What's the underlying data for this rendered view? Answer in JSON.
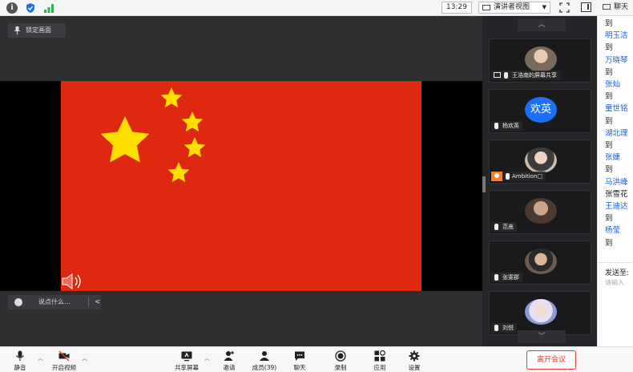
{
  "topbar": {
    "time": "13:29",
    "view_mode": "演讲者视图",
    "chat_title": "聊天",
    "icons": [
      "info-icon",
      "shield-icon",
      "signal-icon",
      "fullscreen-icon",
      "sidebar-icon"
    ]
  },
  "main": {
    "lock_button": "锁定画面",
    "say_placeholder": "说点什么...",
    "say_chevron": "<",
    "shared_content": "chinese-flag"
  },
  "participants": {
    "scroll_up": "^",
    "scroll_down": "v",
    "tiles": [
      {
        "name": "王浩南的屏幕共享",
        "avatar": "photo"
      },
      {
        "name": "杨欢英",
        "avatar_text": "欢英"
      },
      {
        "name": "Ambition□",
        "avatar": "photo",
        "host": true
      },
      {
        "name": "范嵩",
        "avatar": "photo"
      },
      {
        "name": "张雯郡",
        "avatar": "photo"
      },
      {
        "name": "刘悦",
        "avatar": "photo"
      }
    ]
  },
  "chat": {
    "lines": [
      {
        "text": "到",
        "type": "plain"
      },
      {
        "text": "明玉洁",
        "type": "name"
      },
      {
        "text": "到",
        "type": "plain"
      },
      {
        "text": "万晓琴",
        "type": "name"
      },
      {
        "text": "到",
        "type": "plain"
      },
      {
        "text": "张灿",
        "type": "name"
      },
      {
        "text": "到",
        "type": "plain"
      },
      {
        "text": "童世铭",
        "type": "name"
      },
      {
        "text": "到",
        "type": "plain"
      },
      {
        "text": "湖北理",
        "type": "name"
      },
      {
        "text": "到",
        "type": "plain"
      },
      {
        "text": "张婕",
        "type": "name"
      },
      {
        "text": "到",
        "type": "plain"
      },
      {
        "text": "马洪峰",
        "type": "name"
      },
      {
        "text": "张雪花",
        "type": "plain"
      },
      {
        "text": "王迪达",
        "type": "name"
      },
      {
        "text": "到",
        "type": "plain"
      },
      {
        "text": "杨莹",
        "type": "name"
      },
      {
        "text": "到",
        "type": "plain"
      }
    ],
    "send_to": "发送至:",
    "input_placeholder": "请输入"
  },
  "toolbar": {
    "mute": "静音",
    "video": "开启视频",
    "share": "共享屏幕",
    "invite": "邀请",
    "members": "成员(39)",
    "chat": "聊天",
    "record": "录制",
    "apps": "应用",
    "settings": "设置",
    "leave": "离开会议"
  },
  "colors": {
    "flag_red": "#de2910",
    "flag_yellow": "#ffde00",
    "leave_red": "#e23c2f",
    "name_blue": "#1a5ed8",
    "avatar_blue": "#1e6ff5"
  }
}
